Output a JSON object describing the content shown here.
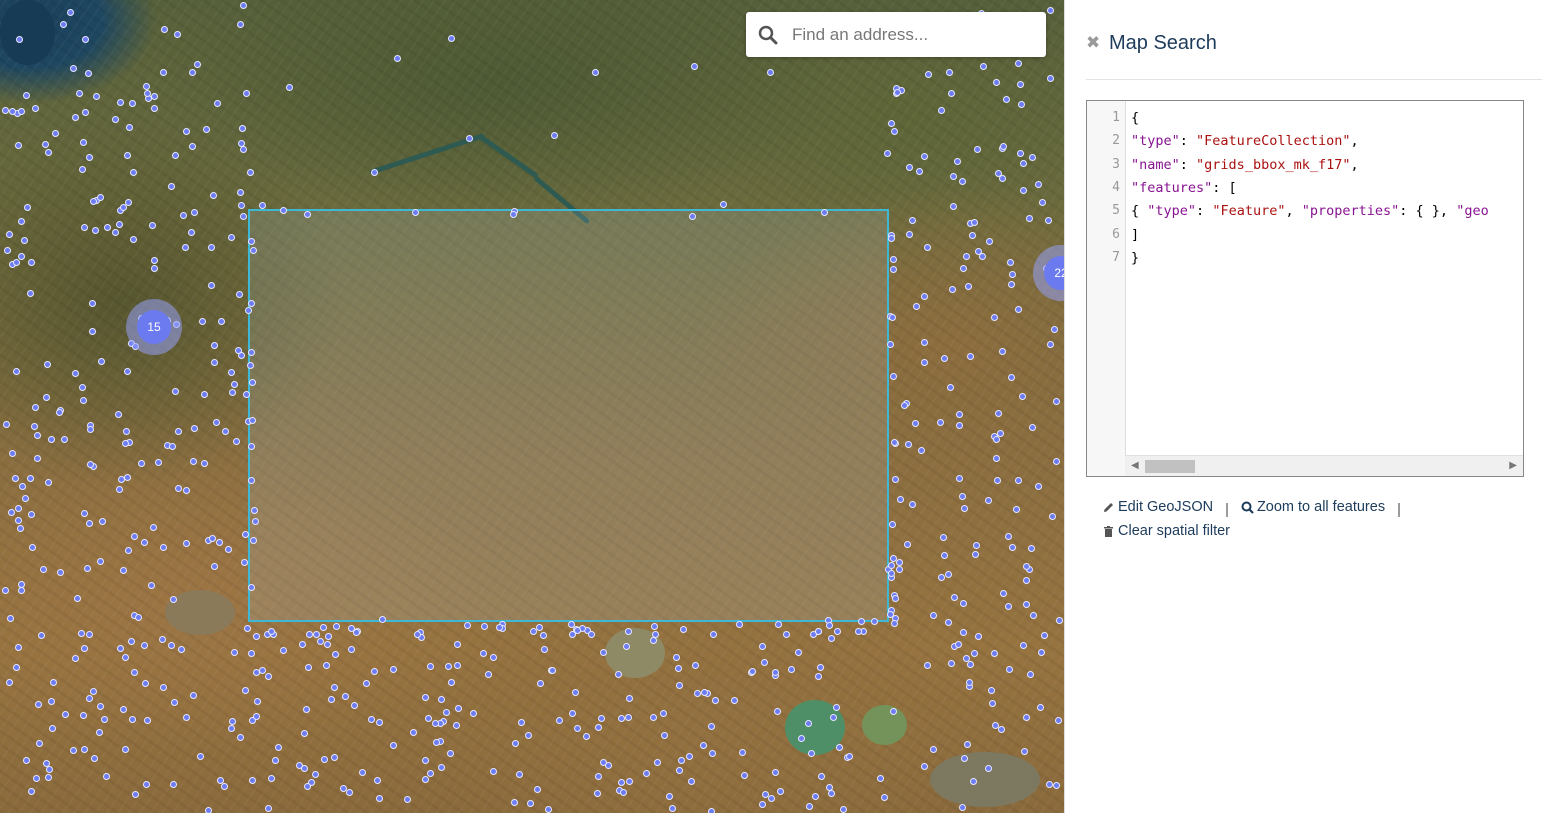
{
  "map": {
    "search_placeholder": "Find an address...",
    "clusters": [
      {
        "label": "15"
      },
      {
        "label": "22"
      }
    ],
    "colors": {
      "marker": "#6d7cf2",
      "bbox_border": "#3fb8d6"
    }
  },
  "panel": {
    "title": "Map Search",
    "close_icon": "times-icon",
    "geojson_lines": [
      {
        "n": "1",
        "tokens": [
          {
            "t": "{",
            "c": "p"
          }
        ]
      },
      {
        "n": "2",
        "tokens": [
          {
            "t": "\"type\"",
            "c": "key"
          },
          {
            "t": ": ",
            "c": "p"
          },
          {
            "t": "\"FeatureCollection\"",
            "c": "str"
          },
          {
            "t": ",",
            "c": "p"
          }
        ]
      },
      {
        "n": "3",
        "tokens": [
          {
            "t": "\"name\"",
            "c": "key"
          },
          {
            "t": ": ",
            "c": "p"
          },
          {
            "t": "\"grids_bbox_mk_f17\"",
            "c": "str"
          },
          {
            "t": ",",
            "c": "p"
          }
        ]
      },
      {
        "n": "4",
        "tokens": [
          {
            "t": "\"features\"",
            "c": "key"
          },
          {
            "t": ": [",
            "c": "p"
          }
        ]
      },
      {
        "n": "5",
        "tokens": [
          {
            "t": "{ ",
            "c": "p"
          },
          {
            "t": "\"type\"",
            "c": "key"
          },
          {
            "t": ": ",
            "c": "p"
          },
          {
            "t": "\"Feature\"",
            "c": "str"
          },
          {
            "t": ", ",
            "c": "p"
          },
          {
            "t": "\"properties\"",
            "c": "key"
          },
          {
            "t": ": { }, ",
            "c": "p"
          },
          {
            "t": "\"geo",
            "c": "key"
          }
        ]
      },
      {
        "n": "6",
        "tokens": [
          {
            "t": "]",
            "c": "p"
          }
        ]
      },
      {
        "n": "7",
        "tokens": [
          {
            "t": "}",
            "c": "p"
          }
        ]
      }
    ],
    "actions": {
      "edit_label": "Edit GeoJSON",
      "zoom_label": "Zoom to all features",
      "clear_label": "Clear spatial filter",
      "separator": "|"
    }
  }
}
